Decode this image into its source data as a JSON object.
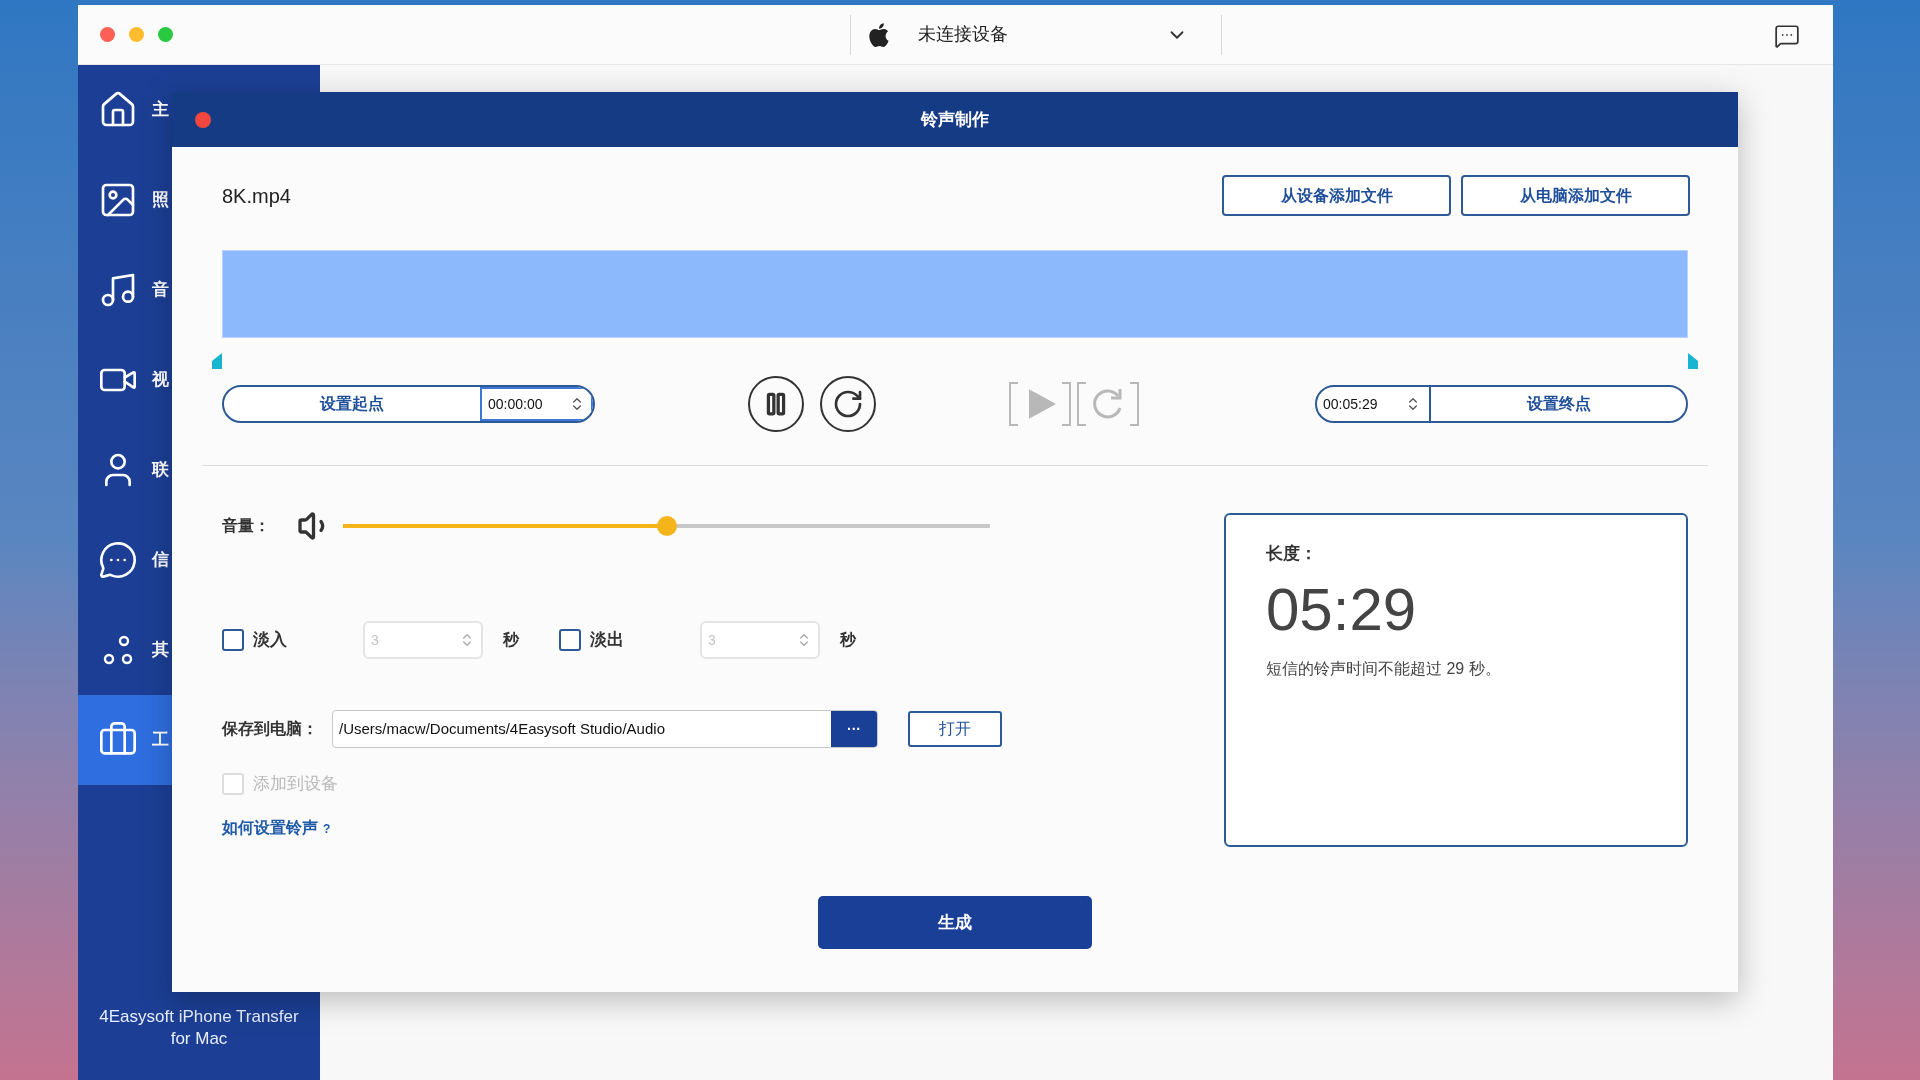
{
  "title_bar": {
    "device": "未连接设备"
  },
  "sidebar": {
    "items": [
      {
        "label": "主",
        "kind": "home",
        "selected": false
      },
      {
        "label": "照",
        "kind": "photo",
        "selected": false
      },
      {
        "label": "音",
        "kind": "music",
        "selected": false
      },
      {
        "label": "视",
        "kind": "video",
        "selected": false
      },
      {
        "label": "联",
        "kind": "contact",
        "selected": false
      },
      {
        "label": "信",
        "kind": "message",
        "selected": false
      },
      {
        "label": "其",
        "kind": "other",
        "selected": false
      },
      {
        "label": "工",
        "kind": "tools",
        "selected": true
      }
    ],
    "footer": "4Easysoft iPhone Transfer for Mac"
  },
  "dialog": {
    "title": "铃声制作",
    "file_name": "8K.mp4",
    "add_buttons": [
      "从设备添加文件",
      "从电脑添加文件"
    ],
    "start": {
      "button": "设置起点",
      "time": "00:00:00"
    },
    "end": {
      "time": "00:05:29",
      "button": "设置终点"
    },
    "volume": {
      "label": "音量：",
      "level": 0.5
    },
    "fades": [
      {
        "label": "淡入",
        "checked": false,
        "value": "3",
        "disabled": true,
        "unit": "秒"
      },
      {
        "label": "淡出",
        "checked": false,
        "value": "3",
        "disabled": true,
        "unit": "秒"
      }
    ],
    "save": {
      "label": "保存到电脑：",
      "path": "/Users/macw/Documents/4Easysoft Studio/Audio",
      "browse": "···",
      "open": "打开"
    },
    "add_to_device": {
      "label": "添加到设备",
      "checked": false,
      "disabled": true
    },
    "help_link": {
      "text": "如何设置铃声",
      "mark": "?"
    },
    "length": {
      "label": "长度：",
      "value": "05:29",
      "note": "短信的铃声时间不能超过 29 秒。"
    },
    "generate": "生成"
  }
}
